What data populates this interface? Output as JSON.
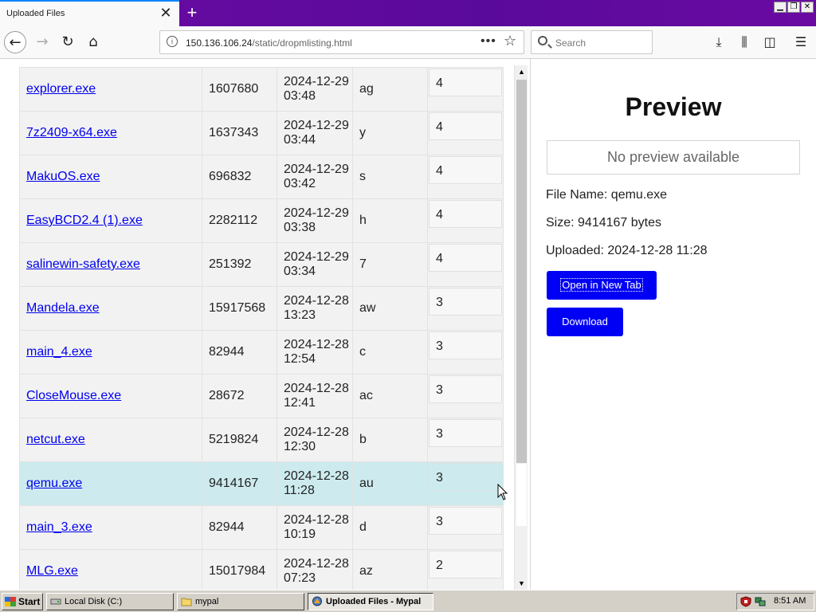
{
  "browser": {
    "tab_title": "Uploaded Files",
    "tab_close": "✕",
    "new_tab": "+",
    "url_host": "150.136.106.24",
    "url_path": "/static/dropmlisting.html",
    "url_dots": "•••",
    "search_placeholder": "Search"
  },
  "files": [
    {
      "name": "explorer.exe",
      "size": "1607680",
      "date": "2024-12-29",
      "time": "03:48",
      "code": "ag",
      "count": "4"
    },
    {
      "name": "7z2409-x64.exe",
      "size": "1637343",
      "date": "2024-12-29",
      "time": "03:44",
      "code": "y",
      "count": "4"
    },
    {
      "name": "MakuOS.exe",
      "size": "696832",
      "date": "2024-12-29",
      "time": "03:42",
      "code": "s",
      "count": "4"
    },
    {
      "name": "EasyBCD2.4 (1).exe",
      "size": "2282112",
      "date": "2024-12-29",
      "time": "03:38",
      "code": "h",
      "count": "4"
    },
    {
      "name": "salinewin-safety.exe",
      "size": "251392",
      "date": "2024-12-29",
      "time": "03:34",
      "code": "7",
      "count": "4"
    },
    {
      "name": "Mandela.exe",
      "size": "15917568",
      "date": "2024-12-28",
      "time": "13:23",
      "code": "aw",
      "count": "3"
    },
    {
      "name": "main_4.exe",
      "size": "82944",
      "date": "2024-12-28",
      "time": "12:54",
      "code": "c",
      "count": "3"
    },
    {
      "name": "CloseMouse.exe",
      "size": "28672",
      "date": "2024-12-28",
      "time": "12:41",
      "code": "ac",
      "count": "3"
    },
    {
      "name": "netcut.exe",
      "size": "5219824",
      "date": "2024-12-28",
      "time": "12:30",
      "code": "b",
      "count": "3"
    },
    {
      "name": "qemu.exe",
      "size": "9414167",
      "date": "2024-12-28",
      "time": "11:28",
      "code": "au",
      "count": "3",
      "selected": true
    },
    {
      "name": "main_3.exe",
      "size": "82944",
      "date": "2024-12-28",
      "time": "10:19",
      "code": "d",
      "count": "3"
    },
    {
      "name": "MLG.exe",
      "size": "15017984",
      "date": "2024-12-28",
      "time": "07:23",
      "code": "az",
      "count": "2"
    }
  ],
  "preview": {
    "title": "Preview",
    "no_preview": "No preview available",
    "file_name": "File Name: qemu.exe",
    "size": "Size: 9414167 bytes",
    "uploaded": "Uploaded: 2024-12-28 11:28",
    "open_button": "Open in New Tab",
    "download_button": "Download"
  },
  "taskbar": {
    "start": "Start",
    "tasks": [
      "Local Disk (C:)",
      "mypal",
      "Uploaded Files - Mypal"
    ],
    "clock": "8:51 AM"
  },
  "colors": {
    "tabbar": "#6a0aa3",
    "button": "#0000f5",
    "selected_row": "#cdebee",
    "link": "#0000ee"
  }
}
